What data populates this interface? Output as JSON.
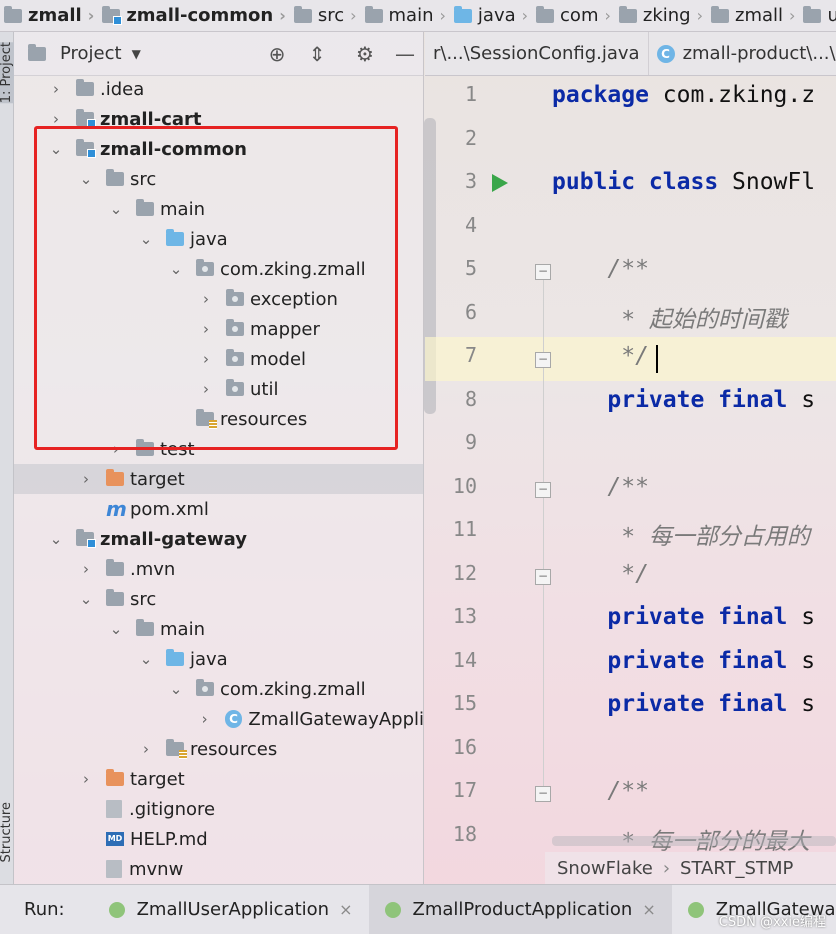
{
  "navbar": {
    "crumbs": [
      {
        "label": "zmall",
        "icon": "folder-icon",
        "bold": true
      },
      {
        "label": "zmall-common",
        "icon": "module-folder-icon",
        "bold": true
      },
      {
        "label": "src",
        "icon": "folder-icon"
      },
      {
        "label": "main",
        "icon": "folder-icon"
      },
      {
        "label": "java",
        "icon": "source-folder-icon"
      },
      {
        "label": "com",
        "icon": "folder-icon"
      },
      {
        "label": "zking",
        "icon": "folder-icon"
      },
      {
        "label": "zmall",
        "icon": "folder-icon"
      },
      {
        "label": "util",
        "icon": "folder-icon"
      }
    ]
  },
  "leftstrip": {
    "project_tab": "1: Project",
    "structure_tab": "Structure"
  },
  "project_panel": {
    "title": "Project",
    "tree": [
      {
        "label": ".idea",
        "depth": 1,
        "arrow": "collapsed",
        "icon": "folder-icon"
      },
      {
        "label": "zmall-cart",
        "depth": 1,
        "arrow": "collapsed",
        "icon": "module-folder-icon",
        "bold": true
      },
      {
        "label": "zmall-common",
        "depth": 1,
        "arrow": "expanded",
        "icon": "module-folder-icon",
        "bold": true
      },
      {
        "label": "src",
        "depth": 2,
        "arrow": "expanded",
        "icon": "folder-icon"
      },
      {
        "label": "main",
        "depth": 3,
        "arrow": "expanded",
        "icon": "folder-icon"
      },
      {
        "label": "java",
        "depth": 4,
        "arrow": "expanded",
        "icon": "source-folder-icon"
      },
      {
        "label": "com.zking.zmall",
        "depth": 5,
        "arrow": "expanded",
        "icon": "package-icon"
      },
      {
        "label": "exception",
        "depth": 6,
        "arrow": "collapsed",
        "icon": "package-icon"
      },
      {
        "label": "mapper",
        "depth": 6,
        "arrow": "collapsed",
        "icon": "package-icon"
      },
      {
        "label": "model",
        "depth": 6,
        "arrow": "collapsed",
        "icon": "package-icon"
      },
      {
        "label": "util",
        "depth": 6,
        "arrow": "collapsed",
        "icon": "package-icon"
      },
      {
        "label": "resources",
        "depth": 5,
        "arrow": "none",
        "icon": "resources-folder-icon"
      },
      {
        "label": "test",
        "depth": 3,
        "arrow": "collapsed",
        "icon": "folder-icon"
      },
      {
        "label": "target",
        "depth": 2,
        "arrow": "collapsed",
        "icon": "excluded-folder-icon",
        "selected": true
      },
      {
        "label": "pom.xml",
        "depth": 2,
        "arrow": "none",
        "icon": "maven-file-icon"
      },
      {
        "label": "zmall-gateway",
        "depth": 1,
        "arrow": "expanded",
        "icon": "module-folder-icon",
        "bold": true
      },
      {
        "label": ".mvn",
        "depth": 2,
        "arrow": "collapsed",
        "icon": "folder-icon"
      },
      {
        "label": "src",
        "depth": 2,
        "arrow": "expanded",
        "icon": "folder-icon"
      },
      {
        "label": "main",
        "depth": 3,
        "arrow": "expanded",
        "icon": "folder-icon"
      },
      {
        "label": "java",
        "depth": 4,
        "arrow": "expanded",
        "icon": "source-folder-icon"
      },
      {
        "label": "com.zking.zmall",
        "depth": 5,
        "arrow": "expanded",
        "icon": "package-icon"
      },
      {
        "label": "ZmallGatewayAppli",
        "depth": 6,
        "arrow": "collapsed",
        "icon": "spring-class-icon"
      },
      {
        "label": "resources",
        "depth": 4,
        "arrow": "collapsed",
        "icon": "resources-folder-icon"
      },
      {
        "label": "target",
        "depth": 2,
        "arrow": "collapsed",
        "icon": "excluded-folder-icon"
      },
      {
        "label": ".gitignore",
        "depth": 2,
        "arrow": "none",
        "icon": "gitignore-file-icon"
      },
      {
        "label": "HELP.md",
        "depth": 2,
        "arrow": "none",
        "icon": "markdown-file-icon"
      },
      {
        "label": "mvnw",
        "depth": 2,
        "arrow": "none",
        "icon": "file-icon"
      }
    ]
  },
  "editor": {
    "tabs": [
      {
        "label": "r\\...\\SessionConfig.java",
        "icon": "none"
      },
      {
        "label": "zmall-product\\...\\",
        "icon": "class-icon"
      }
    ],
    "line_numbers": [
      "1",
      "2",
      "3",
      "4",
      "5",
      "6",
      "7",
      "8",
      "9",
      "10",
      "11",
      "12",
      "13",
      "14",
      "15",
      "16",
      "17",
      "18"
    ],
    "lines": [
      [
        {
          "t": "package",
          "k": "kw"
        },
        {
          "t": " com.zking.z",
          "k": ""
        }
      ],
      [],
      [
        {
          "t": "public class",
          "k": "kw"
        },
        {
          "t": " SnowFl",
          "k": ""
        }
      ],
      [],
      [
        {
          "t": "    /**",
          "k": "cm"
        }
      ],
      [
        {
          "t": "     * 起始的时间戳",
          "k": "cm"
        }
      ],
      [
        {
          "t": "     */",
          "k": "cm"
        }
      ],
      [
        {
          "t": "    private final",
          "k": "kw"
        },
        {
          "t": " s",
          "k": ""
        }
      ],
      [],
      [
        {
          "t": "    /**",
          "k": "cm"
        }
      ],
      [
        {
          "t": "     * 每一部分占用的",
          "k": "cm"
        }
      ],
      [
        {
          "t": "     */",
          "k": "cm"
        }
      ],
      [
        {
          "t": "    private final",
          "k": "kw"
        },
        {
          "t": " s",
          "k": ""
        }
      ],
      [
        {
          "t": "    private final",
          "k": "kw"
        },
        {
          "t": " s",
          "k": ""
        }
      ],
      [
        {
          "t": "    private final",
          "k": "kw"
        },
        {
          "t": " s",
          "k": ""
        }
      ],
      [],
      [
        {
          "t": "    /**",
          "k": "cm"
        }
      ],
      [
        {
          "t": "     * 每一部分的最大",
          "k": "cm"
        }
      ]
    ],
    "breadcrumb": [
      "SnowFlake",
      "START_STMP"
    ]
  },
  "runbar": {
    "label": "Run:",
    "tabs": [
      {
        "label": "ZmallUserApplication",
        "active": false
      },
      {
        "label": "ZmallProductApplication",
        "active": true
      },
      {
        "label": "ZmallGatewayAp",
        "active": false
      }
    ]
  },
  "watermark": "CSDN @xxie编程"
}
